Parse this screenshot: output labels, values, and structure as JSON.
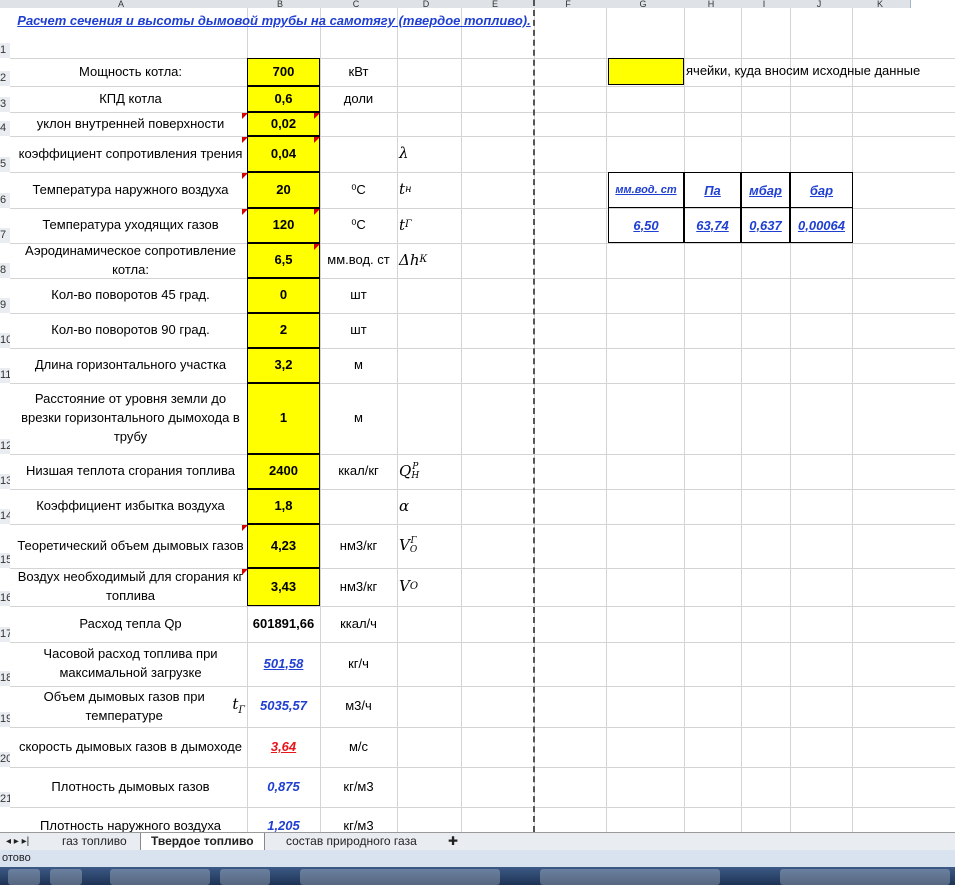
{
  "columns": [
    "A",
    "B",
    "C",
    "D",
    "E",
    "F",
    "G",
    "H",
    "I",
    "J",
    "K"
  ],
  "row_numbers": [
    "1",
    "2",
    "3",
    "4",
    "5",
    "6",
    "7",
    "8",
    "9",
    "10",
    "11",
    "12",
    "13",
    "14",
    "15",
    "16",
    "17",
    "18",
    "19",
    "20",
    "21"
  ],
  "title": "Расчет сечения и высоты дымовой трубы на самотягу   (твердое топливо).",
  "inputs": [
    {
      "label": "Мощность котла:",
      "value": "700",
      "unit": "кВт",
      "symbol": ""
    },
    {
      "label": "КПД котла",
      "value": "0,6",
      "unit": "доли",
      "symbol": ""
    },
    {
      "label": "уклон внутренней поверхности",
      "value": "0,02",
      "unit": "",
      "symbol": ""
    },
    {
      "label": "коэффициент сопротивления трения",
      "value": "0,04",
      "unit": "",
      "symbol": "λ"
    },
    {
      "label": "Температура наружного воздуха",
      "value": "20",
      "unit": "⁰C",
      "symbol": "t н"
    },
    {
      "label": "Температура уходящих газов",
      "value": "120",
      "unit": "⁰C",
      "symbol": "t Г"
    },
    {
      "label": "Аэродинамическое сопротивление котла:",
      "value": "6,5",
      "unit": "мм.вод. ст",
      "symbol": "Δh К"
    },
    {
      "label": "Кол-во поворотов 45 град.",
      "value": "0",
      "unit": "шт",
      "symbol": ""
    },
    {
      "label": "Кол-во поворотов 90 град.",
      "value": "2",
      "unit": "шт",
      "symbol": ""
    },
    {
      "label": "Длина горизонтального участка",
      "value": "3,2",
      "unit": "м",
      "symbol": ""
    },
    {
      "label": "Расстояние от уровня земли до врезки горизонтального дымохода в трубу",
      "value": "1",
      "unit": "м",
      "symbol": ""
    },
    {
      "label": "Низшая теплота сгорания топлива",
      "value": "2400",
      "unit": "ккал/кг",
      "symbol": "Q Р Н"
    },
    {
      "label": "Коэффициент избытка воздуха",
      "value": "1,8",
      "unit": "",
      "symbol": "α"
    },
    {
      "label": "Теоретический объем дымовых газов",
      "value": "4,23",
      "unit": "нм3/кг",
      "symbol": "V Г O"
    },
    {
      "label": "Воздух необходимый для сгорания кг  топлива",
      "value": "3,43",
      "unit": "нм3/кг",
      "symbol": "V O"
    }
  ],
  "results": [
    {
      "label": "Расход тепла  Qр",
      "value": "601891,66",
      "unit": "ккал/ч"
    },
    {
      "label": "Часовой расход топлива при максимальной загрузке",
      "value": "501,58",
      "unit": "кг/ч"
    },
    {
      "label": "Объем дымовых газов при температуре",
      "label_symbol": "t Г",
      "value": "5035,57",
      "unit": "м3/ч"
    },
    {
      "label": "скорость дымовых газов в дымоходе",
      "value": "3,64",
      "unit": "м/с"
    },
    {
      "label": "Плотность дымовых газов",
      "value": "0,875",
      "unit": "кг/м3"
    },
    {
      "label": "Плотность наружного воздуха",
      "value": "1,205",
      "unit": "кг/м3"
    }
  ],
  "legend": {
    "text": "ячейки, куда вносим исходные данные",
    "swatch_color": "#ffff00"
  },
  "conversion": {
    "headers": [
      "мм.вод. ст",
      "Па",
      "мбар",
      "бар"
    ],
    "values": [
      "6,50",
      "63,74",
      "0,637",
      "0,00064"
    ]
  },
  "sheet_tabs": [
    "газ топливо",
    "Твердое топливо",
    "состав природного газа"
  ],
  "active_tab": "Твердое топливо",
  "status_text": "отово",
  "colors": {
    "input": "#ffff00",
    "link_blue": "#1f3fd1",
    "alert_red": "#e8151a"
  }
}
